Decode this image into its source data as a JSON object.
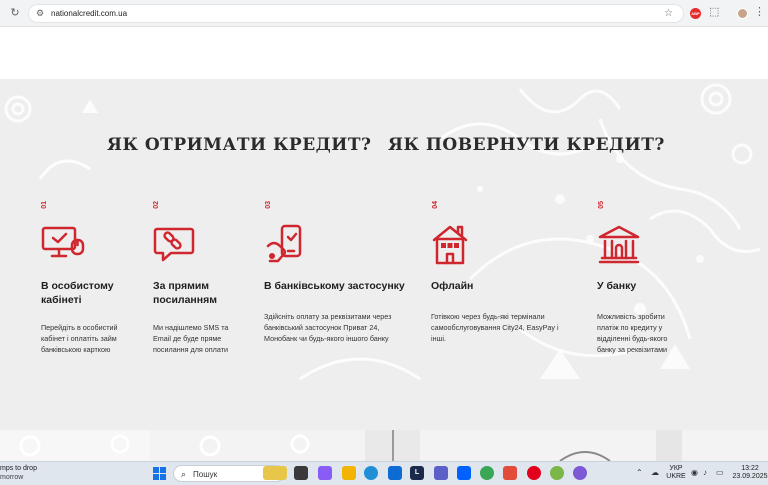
{
  "browser": {
    "url": "nationalcredit.com.ua"
  },
  "headings": {
    "get_credit": "ЯК ОТРИМАТИ КРЕДИТ?",
    "return_credit": "ЯК ПОВЕРНУТИ КРЕДИТ?"
  },
  "steps": [
    {
      "num": "01",
      "title": "В особистому кабінеті",
      "text": "Перейдіть в особистий кабінет і оплатіть займ банківською карткою"
    },
    {
      "num": "02",
      "title": "За прямим посиланням",
      "text": "Ми надішлемо SMS та Email де буде пряме посилання для оплати"
    },
    {
      "num": "03",
      "title": "В банківському застосунку",
      "text": "Здійсніть оплату за реквізитами через банківський застосунок Приват 24, Монобанк чи будь-якого іншого банку"
    },
    {
      "num": "04",
      "title": "Офлайн",
      "text": "Готівкою через будь-які термінали самообслуговування City24, EasyPay і інші."
    },
    {
      "num": "05",
      "title": "У банку",
      "text": "Можливість зробити платіж по кредиту у відділенні будь-якого банку за реквізитами"
    }
  ],
  "taskbar": {
    "notif_line1": "mps to drop",
    "notif_line2": "morrow",
    "search_label": "Пошук",
    "lang_line1": "УКР",
    "lang_line2": "UKRE",
    "time": "13:22",
    "date": "23.09.2025"
  },
  "colors": {
    "accent_red": "#d0262e",
    "heading": "#2b2b2b",
    "section_bg": "#eeeeef"
  }
}
